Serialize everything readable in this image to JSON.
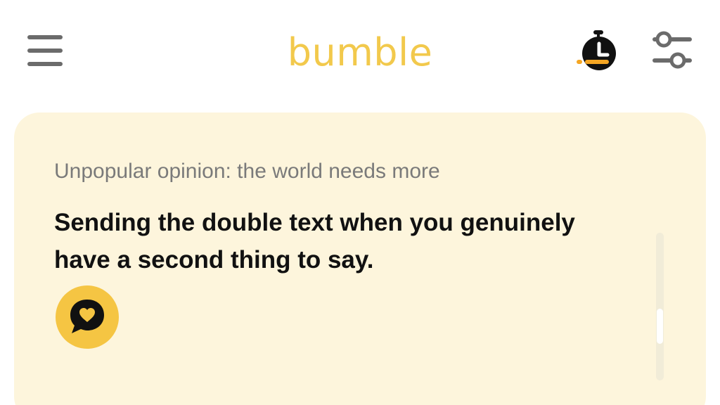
{
  "header": {
    "app_name": "bumble",
    "menu_icon": "hamburger-menu-icon",
    "timer_icon": "stopwatch-icon",
    "filter_icon": "sliders-filter-icon",
    "colors": {
      "brand": "#f2c94c",
      "icon_gray": "#6b6b6b",
      "timer_accent": "#f5a623"
    }
  },
  "card": {
    "prompt": "Unpopular opinion: the world needs more",
    "answer": "Sending the double text when you genuinely have a second thing to say.",
    "react_icon": "heart-speech-bubble-icon",
    "colors": {
      "background": "#fdf5dc",
      "react_button": "#f5c543"
    }
  }
}
